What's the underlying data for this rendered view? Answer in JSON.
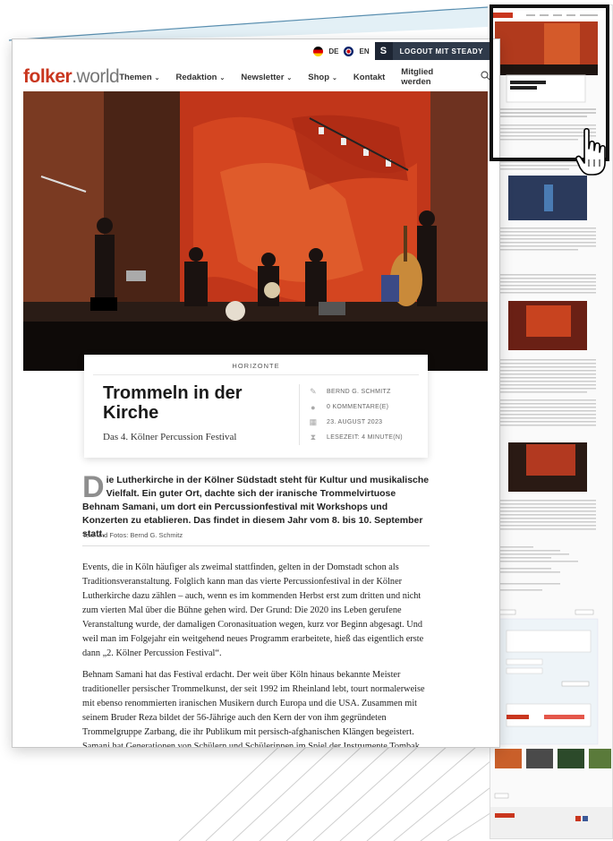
{
  "topbar": {
    "lang_de": "DE",
    "lang_en": "EN",
    "steady_badge": "S",
    "logout_label": "LOGOUT MIT STEADY"
  },
  "logo": {
    "brand": "folker",
    "suffix": ".world"
  },
  "nav": [
    {
      "label": "Themen",
      "dropdown": true
    },
    {
      "label": "Redaktion",
      "dropdown": true
    },
    {
      "label": "Newsletter",
      "dropdown": true
    },
    {
      "label": "Shop",
      "dropdown": true
    },
    {
      "label": "Kontakt",
      "dropdown": false
    },
    {
      "label": "Mitglied werden",
      "dropdown": false
    }
  ],
  "article": {
    "category": "HORIZONTE",
    "title": "Trommeln in der Kirche",
    "subtitle": "Das 4. Kölner Percussion Festival",
    "author": "BERND G. SCHMITZ",
    "comments": "0 KOMMENTARE(E)",
    "date": "23. AUGUST 2023",
    "reading_time": "LESEZEIT: 4 MINUTE(N)",
    "lead_dropcap": "D",
    "lead_rest": "ie Lutherkirche in der Kölner Südstadt steht für Kultur und musikalische Vielfalt. Ein guter Ort, dachte sich der iranische Trommelvirtuose Behnam Samani, um dort ein Percussionfestival mit Workshops und Konzerten zu etablieren. Das findet in diesem Jahr vom 8. bis 10. September statt.",
    "credit": "Text und Fotos: Bernd G. Schmitz",
    "paragraph_1": "Events, die in Köln häufiger als zweimal stattfinden, gelten in der Domstadt schon als Traditionsveranstaltung. Folglich kann man das vierte Percussionfestival in der Kölner Lutherkirche dazu zählen – auch, wenn es im kommenden Herbst erst zum dritten und nicht zum vierten Mal über die Bühne gehen wird. Der Grund: Die 2020 ins Leben gerufene Veranstaltung wurde, der damaligen Coronasituation wegen, kurz vor Beginn abgesagt. Und weil man im Folgejahr ein weitgehend neues Programm erarbeitete, hieß das eigentlich erste dann „2. Kölner Percussion Festival“.",
    "paragraph_2": "Behnam Samani hat das Festival erdacht. Der weit über Köln hinaus bekannte Meister traditioneller persischer Trommelkunst, der seit 1992 im Rheinland lebt, tourt normalerweise mit ebenso renommierten iranischen Musikern durch Europa und die USA. Zusammen mit seinem Bruder Reza bildet der 56-Jährige auch den Kern der von ihm gegründeten Trommelgruppe Zarbang, die ihr Publikum mit persisch-afghanischen Klängen begeistert. Samani hat Generationen von Schülern und Schülerinnen im Spiel der Instrumente Tombak und Daf unterrichtet. Die hölzerne Bechertrommel und die innen mit"
  },
  "sidebar_preview": {
    "logo_brand": "folker",
    "logo_suffix": ".world",
    "title": "Trommeln in der Kirche"
  },
  "colors": {
    "brand_red": "#c9361e",
    "steady_bg": "#2f3a4a",
    "page_bg": "#ffffff"
  },
  "icons": [
    "flag-de-icon",
    "flag-en-icon",
    "search-icon",
    "pen-icon",
    "comment-icon",
    "calendar-icon",
    "hourglass-icon",
    "hand-pointer-icon"
  ]
}
